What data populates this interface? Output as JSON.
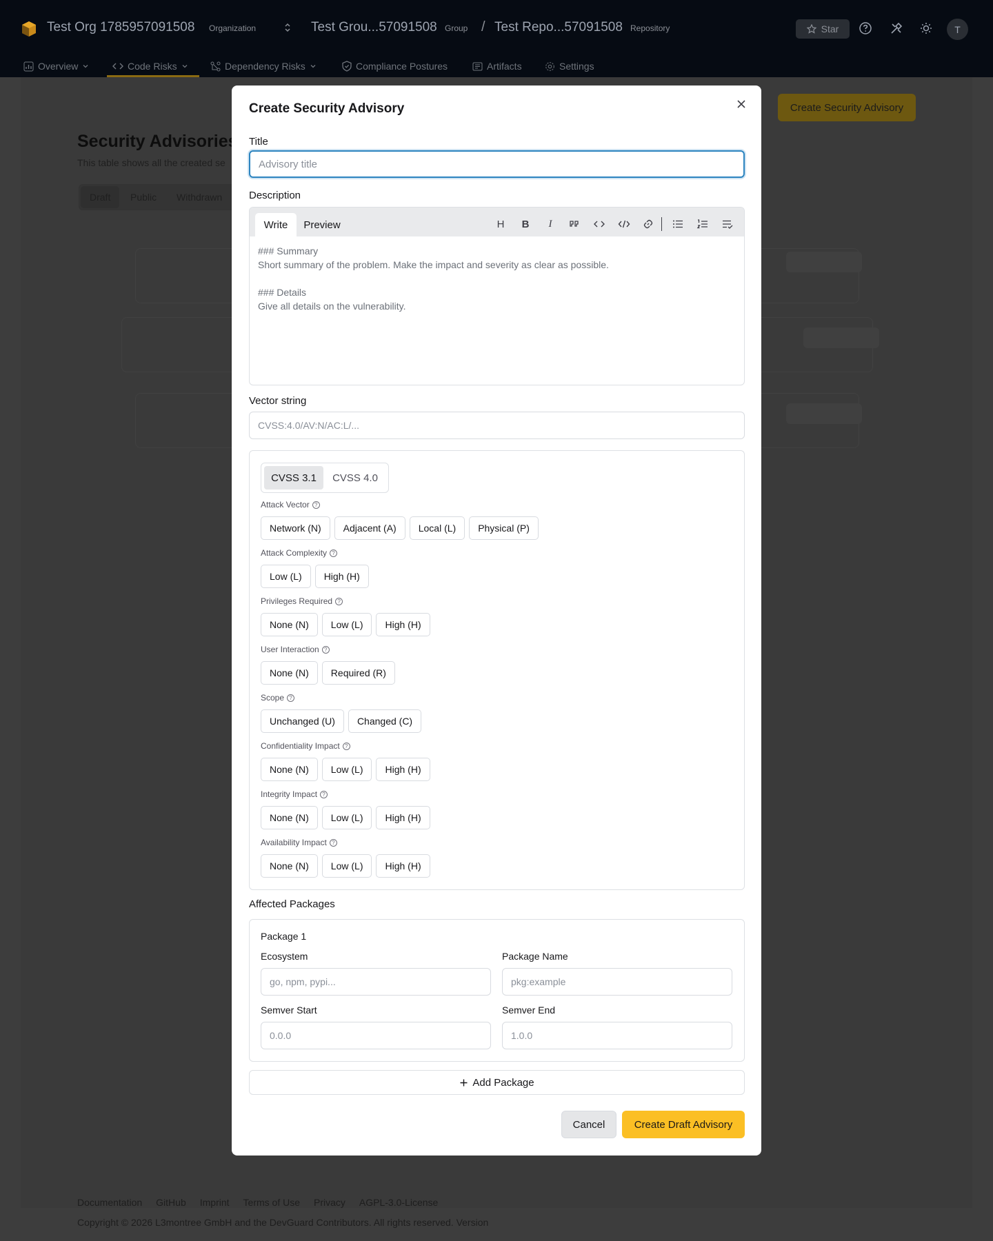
{
  "header": {
    "org_name": "Test Org 1785957091508",
    "org_kind": "Organization",
    "group_name": "Test Grou...57091508",
    "group_kind": "Group",
    "separator": "/",
    "repo_name": "Test Repo...57091508",
    "repo_kind": "Repository",
    "star_label": "Star",
    "avatar_initial": "T"
  },
  "nav": {
    "items": [
      {
        "label": "Overview",
        "icon": "chart-icon",
        "has_dropdown": true
      },
      {
        "label": "Code Risks",
        "icon": "code-icon",
        "has_dropdown": true,
        "active": true
      },
      {
        "label": "Dependency Risks",
        "icon": "dependency-icon",
        "has_dropdown": true
      },
      {
        "label": "Compliance Postures",
        "icon": "shield-icon",
        "has_dropdown": false
      },
      {
        "label": "Artifacts",
        "icon": "artifact-icon",
        "has_dropdown": false
      },
      {
        "label": "Settings",
        "icon": "gear-icon",
        "has_dropdown": false
      }
    ]
  },
  "background_page": {
    "create_button": "Create Security Advisory",
    "title": "Security Advisories",
    "description": "This table shows all the created se",
    "tabs": [
      "Draft",
      "Public",
      "Withdrawn"
    ]
  },
  "footer": {
    "links": [
      "Documentation",
      "GitHub",
      "Imprint",
      "Terms of Use",
      "Privacy",
      "AGPL-3.0-License"
    ],
    "copyright": "Copyright © 2026 L3montree GmbH and the DevGuard Contributors. All rights reserved. Version"
  },
  "modal": {
    "title": "Create Security Advisory",
    "title_label": "Title",
    "title_placeholder": "Advisory title",
    "description_label": "Description",
    "editor_tabs": [
      "Write",
      "Preview"
    ],
    "editor_tools": [
      "heading-icon",
      "bold-icon",
      "italic-icon",
      "quote-icon",
      "code-icon",
      "code-block-icon",
      "link-icon",
      "bullet-list-icon",
      "numbered-list-icon",
      "task-list-icon"
    ],
    "editor_text": "### Summary\nShort summary of the problem. Make the impact and severity as clear as possible.\n\n### Details\nGive all details on the vulnerability.",
    "vector_label": "Vector string",
    "vector_placeholder": "CVSS:4.0/AV:N/AC:L/...",
    "cvss_versions": [
      "CVSS 3.1",
      "CVSS 4.0"
    ],
    "cvss_selected": "CVSS 3.1",
    "metrics": [
      {
        "label": "Attack Vector",
        "options": [
          "Network (N)",
          "Adjacent (A)",
          "Local (L)",
          "Physical (P)"
        ]
      },
      {
        "label": "Attack Complexity",
        "options": [
          "Low (L)",
          "High (H)"
        ]
      },
      {
        "label": "Privileges Required",
        "options": [
          "None (N)",
          "Low (L)",
          "High (H)"
        ]
      },
      {
        "label": "User Interaction",
        "options": [
          "None (N)",
          "Required (R)"
        ]
      },
      {
        "label": "Scope",
        "options": [
          "Unchanged (U)",
          "Changed (C)"
        ]
      },
      {
        "label": "Confidentiality Impact",
        "options": [
          "None (N)",
          "Low (L)",
          "High (H)"
        ]
      },
      {
        "label": "Integrity Impact",
        "options": [
          "None (N)",
          "Low (L)",
          "High (H)"
        ]
      },
      {
        "label": "Availability Impact",
        "options": [
          "None (N)",
          "Low (L)",
          "High (H)"
        ]
      }
    ],
    "affected_label": "Affected Packages",
    "package": {
      "title": "Package 1",
      "ecosystem_label": "Ecosystem",
      "ecosystem_placeholder": "go, npm, pypi...",
      "name_label": "Package Name",
      "name_placeholder": "pkg:example",
      "semver_start_label": "Semver Start",
      "semver_start_placeholder": "0.0.0",
      "semver_end_label": "Semver End",
      "semver_end_placeholder": "1.0.0"
    },
    "add_package_label": "Add Package",
    "cancel_label": "Cancel",
    "submit_label": "Create Draft Advisory"
  },
  "colors": {
    "accent": "#fbbf24",
    "focus_ring": "#2c84bf",
    "header_bg": "#060b13"
  }
}
